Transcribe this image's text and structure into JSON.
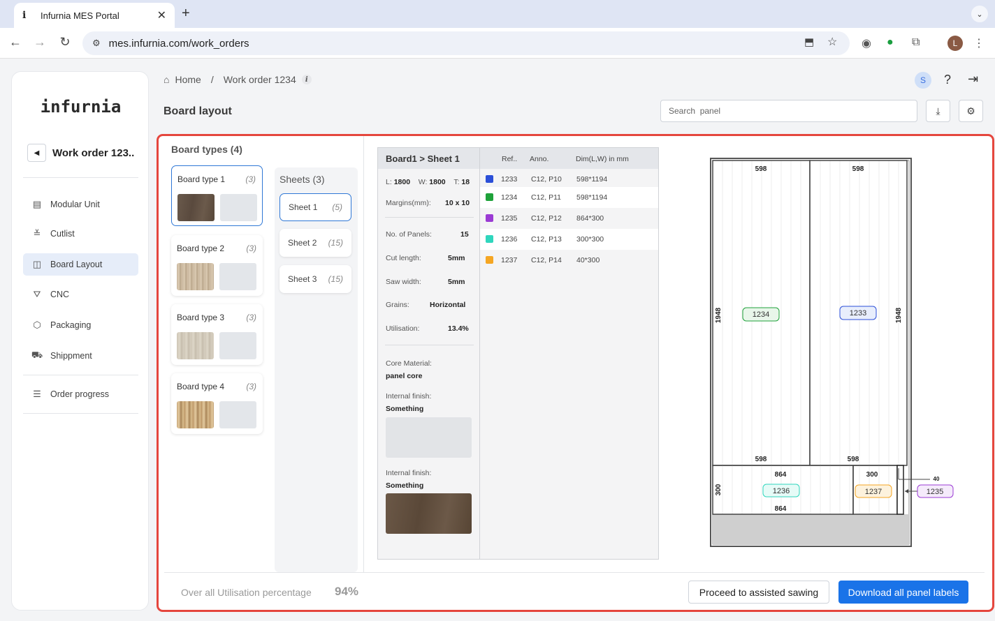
{
  "browser": {
    "tab_title": "Infurnia MES Portal",
    "url": "mes.infurnia.com/work_orders",
    "profile_initial": "L"
  },
  "sidebar": {
    "logo": "infurnia",
    "work_order": "Work order 123..",
    "items": [
      {
        "label": "Modular Unit",
        "icon": "cabinet-icon"
      },
      {
        "label": "Cutlist",
        "icon": "cutlist-icon"
      },
      {
        "label": "Board Layout",
        "icon": "layout-icon",
        "active": true
      },
      {
        "label": "CNC",
        "icon": "cnc-icon"
      },
      {
        "label": "Packaging",
        "icon": "box-icon"
      },
      {
        "label": "Shippment",
        "icon": "truck-icon"
      },
      {
        "label": "Order progress",
        "icon": "list-icon"
      }
    ]
  },
  "header": {
    "breadcrumb_home": "Home",
    "breadcrumb_current": "Work order 1234",
    "avatar_initial": "S",
    "page_title": "Board layout",
    "search_placeholder": "Search  panel"
  },
  "board_types": {
    "title": "Board types (4)",
    "items": [
      {
        "name": "Board type 1",
        "count": "(3)",
        "selected": true
      },
      {
        "name": "Board type 2",
        "count": "(3)"
      },
      {
        "name": "Board type 3",
        "count": "(3)"
      },
      {
        "name": "Board type 4",
        "count": "(3)"
      }
    ]
  },
  "sheets": {
    "title": "Sheets (3)",
    "items": [
      {
        "name": "Sheet 1",
        "count": "(5)",
        "selected": true
      },
      {
        "name": "Sheet 2",
        "count": "(15)"
      },
      {
        "name": "Sheet 3",
        "count": "(15)"
      }
    ]
  },
  "info": {
    "header": "Board1 > Sheet  1",
    "L_label": "L:",
    "L": "1800",
    "W_label": "W:",
    "W": "1800",
    "T_label": "T:",
    "T": "18",
    "margins_label": "Margins(mm):",
    "margins": "10 x 10",
    "panels_label": "No. of Panels:",
    "panels": "15",
    "cut_label": "Cut length:",
    "cut": "5mm",
    "saw_label": "Saw width:",
    "saw": "5mm",
    "grains_label": "Grains:",
    "grains": "Horizontal",
    "util_label": "Utilisation:",
    "util": "13.4%",
    "core_label": "Core Material:",
    "core": "panel core",
    "finish1_label": "Internal finish:",
    "finish1": "Something",
    "finish2_label": "Internal finish:",
    "finish2": "Something"
  },
  "panel_table": {
    "headers": [
      "Ref..",
      "Anno.",
      "Dim(L,W) in mm"
    ],
    "rows": [
      {
        "ref": "1233",
        "anno": "C12, P10",
        "dim": "598*1194",
        "color": "#2b4fd8"
      },
      {
        "ref": "1234",
        "anno": "C12, P11",
        "dim": "598*1194",
        "color": "#1fa23a"
      },
      {
        "ref": "1235",
        "anno": "C12, P12",
        "dim": "864*300",
        "color": "#9b3bd4"
      },
      {
        "ref": "1236",
        "anno": "C12, P13",
        "dim": "300*300",
        "color": "#2fd6bd"
      },
      {
        "ref": "1237",
        "anno": "C12, P14",
        "dim": "40*300",
        "color": "#f5a623"
      }
    ]
  },
  "diagram": {
    "top_left": "598",
    "top_right": "598",
    "left_side": "1948",
    "right_side": "1948",
    "bottom_left": "598",
    "bottom_right": "598",
    "tag_1234": "1234",
    "tag_1233": "1233",
    "mid_top": "864",
    "mid_bottom": "864",
    "left_small": "300",
    "small_top": "300",
    "tag_1236": "1236",
    "tag_1237": "1237",
    "strip_width": "40",
    "tag_1235": "1235"
  },
  "footer": {
    "util_label": "Over all Utilisation percentage",
    "util_value": "94%",
    "proceed_label": "Proceed to assisted sawing",
    "download_label": "Download all panel labels"
  }
}
